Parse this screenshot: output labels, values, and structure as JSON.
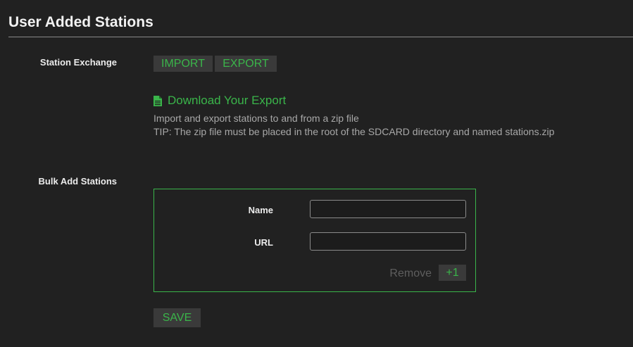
{
  "section": {
    "title": "User Added Stations"
  },
  "exchange": {
    "label": "Station Exchange",
    "import_label": "IMPORT",
    "export_label": "EXPORT",
    "download_link": "Download Your Export",
    "help_line_1": "Import and export stations to and from a zip file",
    "help_line_2": "TIP: The zip file must be placed in the root of the SDCARD directory and named stations.zip"
  },
  "bulk": {
    "label": "Bulk Add Stations",
    "name_label": "Name",
    "name_value": "",
    "url_label": "URL",
    "url_value": "",
    "remove_label": "Remove",
    "add_label": "+1",
    "save_label": "SAVE"
  },
  "colors": {
    "background": "#212121",
    "accent": "#3ab54a",
    "button_bg": "#3a3a3a",
    "muted_text": "#a8a8a8"
  },
  "icons": {
    "download": "file-icon"
  }
}
